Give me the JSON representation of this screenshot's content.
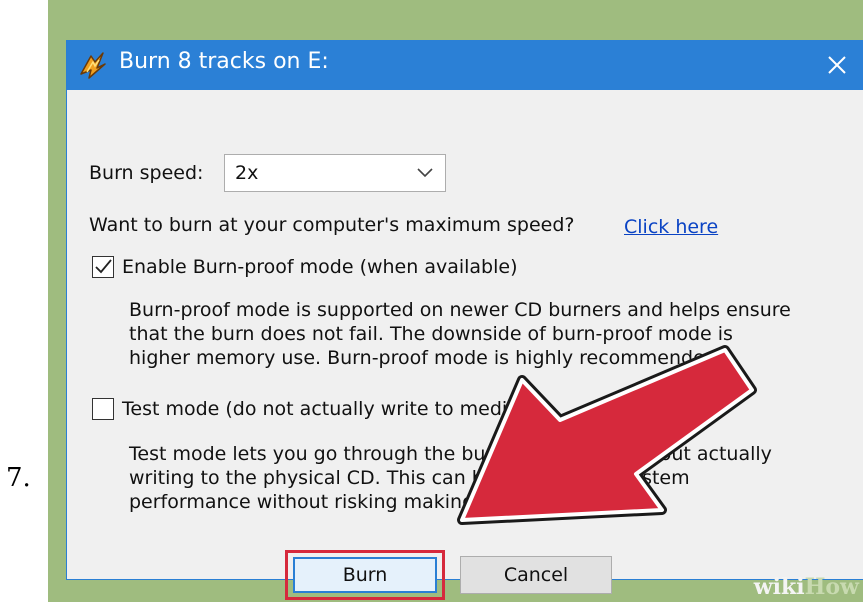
{
  "step": {
    "number": "7."
  },
  "dialog": {
    "title": "Burn 8 tracks on E:",
    "burn_speed": {
      "label": "Burn speed:",
      "value": "2x"
    },
    "max_speed": {
      "question": "Want to burn at your computer's maximum speed?",
      "link": "Click here"
    },
    "burn_proof": {
      "label": "Enable Burn-proof mode (when available)",
      "checked": true,
      "description": [
        "Burn-proof mode is supported on newer CD burners and helps ensure",
        "that the burn does not fail. The downside of burn-proof mode is",
        "higher memory use. Burn-proof mode is highly recommended."
      ]
    },
    "test_mode": {
      "label": "Test mode (do not actually write to media)",
      "checked": false,
      "description": [
        "Test mode lets you go through the burning process without actually",
        "writing to the physical CD. This can be used to test system",
        "performance without risking making unusable CDs."
      ]
    },
    "buttons": {
      "burn": "Burn",
      "cancel": "Cancel"
    }
  },
  "colors": {
    "titlebar": "#2b80d6",
    "highlight": "#d6293c",
    "arrow": "#d6293c",
    "frame": "#9fbc7f"
  },
  "watermark": {
    "part1": "wiki",
    "part2": "How"
  }
}
